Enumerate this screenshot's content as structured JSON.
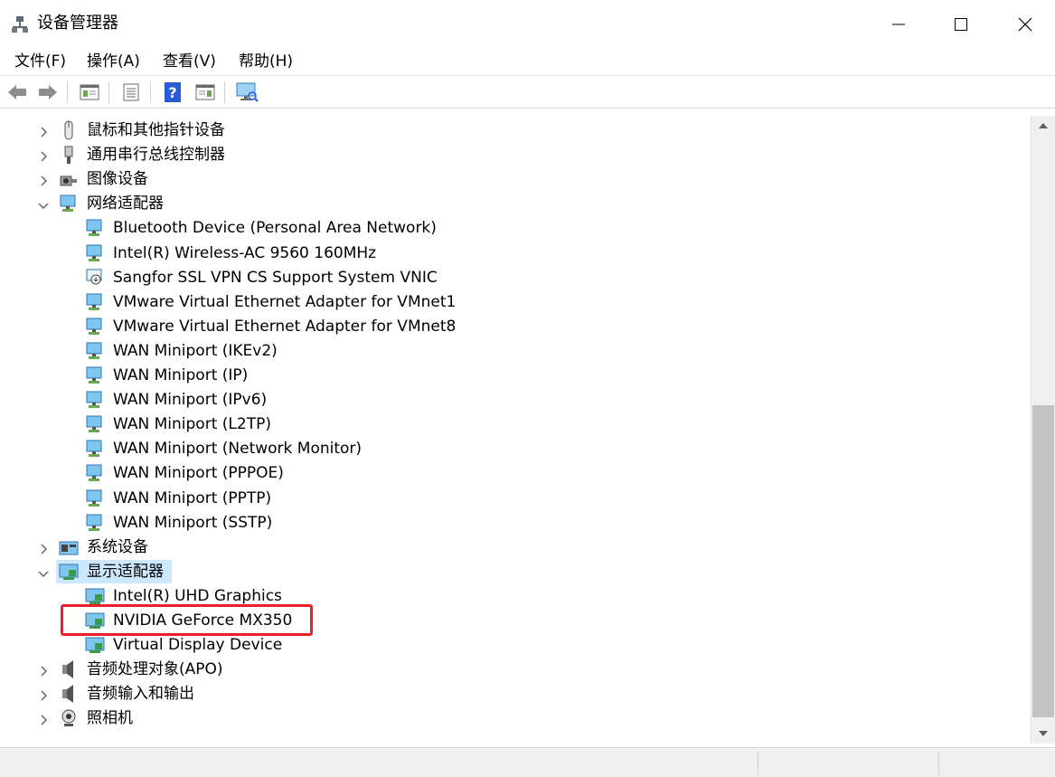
{
  "window": {
    "title": "设备管理器"
  },
  "menu": [
    "文件(F)",
    "操作(A)",
    "查看(V)",
    "帮助(H)"
  ],
  "toolbar": [
    "back-icon",
    "forward-icon",
    "properties-icon",
    "list-icon",
    "help-icon",
    "view-icon",
    "monitor-icon"
  ],
  "tree": {
    "categories_top": [
      {
        "label": "鼠标和其他指针设备",
        "expanded": false,
        "icon": "mouse-icon"
      },
      {
        "label": "通用串行总线控制器",
        "expanded": false,
        "icon": "usb-icon"
      },
      {
        "label": "图像设备",
        "expanded": false,
        "icon": "camera-icon"
      }
    ],
    "network": {
      "label": "网络适配器",
      "expanded": true,
      "children": [
        "Bluetooth Device (Personal Area Network)",
        "Intel(R) Wireless-AC 9560 160MHz",
        "Sangfor SSL VPN CS Support System VNIC",
        "VMware Virtual Ethernet Adapter for VMnet1",
        "VMware Virtual Ethernet Adapter for VMnet8",
        "WAN Miniport (IKEv2)",
        "WAN Miniport (IP)",
        "WAN Miniport (IPv6)",
        "WAN Miniport (L2TP)",
        "WAN Miniport (Network Monitor)",
        "WAN Miniport (PPPOE)",
        "WAN Miniport (PPTP)",
        "WAN Miniport (SSTP)"
      ]
    },
    "system": {
      "label": "系统设备",
      "expanded": false
    },
    "display": {
      "label": "显示适配器",
      "expanded": true,
      "selected": true,
      "children": [
        "Intel(R) UHD Graphics",
        "NVIDIA GeForce MX350",
        "Virtual Display Device"
      ]
    },
    "categories_bottom": [
      {
        "label": "音频处理对象(APO)",
        "expanded": false,
        "icon": "speaker-icon"
      },
      {
        "label": "音频输入和输出",
        "expanded": false,
        "icon": "speaker-icon"
      },
      {
        "label": "照相机",
        "expanded": false,
        "icon": "webcam-icon"
      }
    ]
  },
  "colors": {
    "selection": "#cce8ff",
    "highlight": "#e8202a",
    "scroll_thumb": "#c2c2c2"
  }
}
